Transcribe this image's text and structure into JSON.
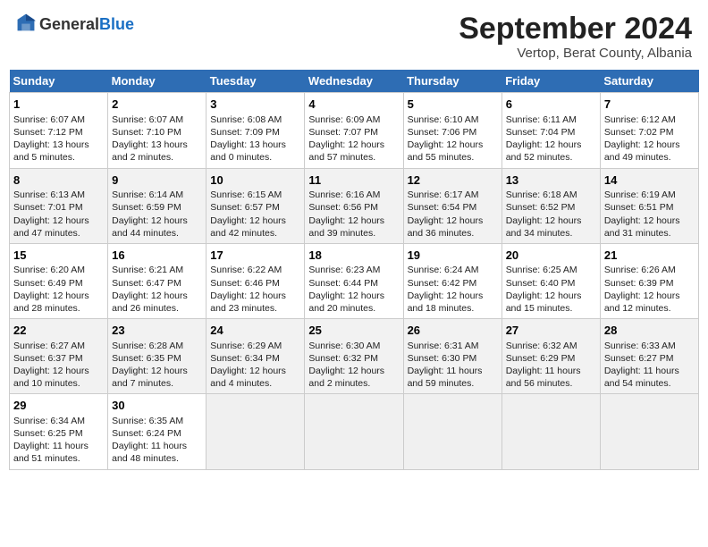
{
  "header": {
    "logo_general": "General",
    "logo_blue": "Blue",
    "month_title": "September 2024",
    "location": "Vertop, Berat County, Albania"
  },
  "columns": [
    "Sunday",
    "Monday",
    "Tuesday",
    "Wednesday",
    "Thursday",
    "Friday",
    "Saturday"
  ],
  "weeks": [
    [
      {
        "day": "1",
        "sunrise": "6:07 AM",
        "sunset": "7:12 PM",
        "daylight": "13 hours and 5 minutes."
      },
      {
        "day": "2",
        "sunrise": "6:07 AM",
        "sunset": "7:10 PM",
        "daylight": "13 hours and 2 minutes."
      },
      {
        "day": "3",
        "sunrise": "6:08 AM",
        "sunset": "7:09 PM",
        "daylight": "13 hours and 0 minutes."
      },
      {
        "day": "4",
        "sunrise": "6:09 AM",
        "sunset": "7:07 PM",
        "daylight": "12 hours and 57 minutes."
      },
      {
        "day": "5",
        "sunrise": "6:10 AM",
        "sunset": "7:06 PM",
        "daylight": "12 hours and 55 minutes."
      },
      {
        "day": "6",
        "sunrise": "6:11 AM",
        "sunset": "7:04 PM",
        "daylight": "12 hours and 52 minutes."
      },
      {
        "day": "7",
        "sunrise": "6:12 AM",
        "sunset": "7:02 PM",
        "daylight": "12 hours and 49 minutes."
      }
    ],
    [
      {
        "day": "8",
        "sunrise": "6:13 AM",
        "sunset": "7:01 PM",
        "daylight": "12 hours and 47 minutes."
      },
      {
        "day": "9",
        "sunrise": "6:14 AM",
        "sunset": "6:59 PM",
        "daylight": "12 hours and 44 minutes."
      },
      {
        "day": "10",
        "sunrise": "6:15 AM",
        "sunset": "6:57 PM",
        "daylight": "12 hours and 42 minutes."
      },
      {
        "day": "11",
        "sunrise": "6:16 AM",
        "sunset": "6:56 PM",
        "daylight": "12 hours and 39 minutes."
      },
      {
        "day": "12",
        "sunrise": "6:17 AM",
        "sunset": "6:54 PM",
        "daylight": "12 hours and 36 minutes."
      },
      {
        "day": "13",
        "sunrise": "6:18 AM",
        "sunset": "6:52 PM",
        "daylight": "12 hours and 34 minutes."
      },
      {
        "day": "14",
        "sunrise": "6:19 AM",
        "sunset": "6:51 PM",
        "daylight": "12 hours and 31 minutes."
      }
    ],
    [
      {
        "day": "15",
        "sunrise": "6:20 AM",
        "sunset": "6:49 PM",
        "daylight": "12 hours and 28 minutes."
      },
      {
        "day": "16",
        "sunrise": "6:21 AM",
        "sunset": "6:47 PM",
        "daylight": "12 hours and 26 minutes."
      },
      {
        "day": "17",
        "sunrise": "6:22 AM",
        "sunset": "6:46 PM",
        "daylight": "12 hours and 23 minutes."
      },
      {
        "day": "18",
        "sunrise": "6:23 AM",
        "sunset": "6:44 PM",
        "daylight": "12 hours and 20 minutes."
      },
      {
        "day": "19",
        "sunrise": "6:24 AM",
        "sunset": "6:42 PM",
        "daylight": "12 hours and 18 minutes."
      },
      {
        "day": "20",
        "sunrise": "6:25 AM",
        "sunset": "6:40 PM",
        "daylight": "12 hours and 15 minutes."
      },
      {
        "day": "21",
        "sunrise": "6:26 AM",
        "sunset": "6:39 PM",
        "daylight": "12 hours and 12 minutes."
      }
    ],
    [
      {
        "day": "22",
        "sunrise": "6:27 AM",
        "sunset": "6:37 PM",
        "daylight": "12 hours and 10 minutes."
      },
      {
        "day": "23",
        "sunrise": "6:28 AM",
        "sunset": "6:35 PM",
        "daylight": "12 hours and 7 minutes."
      },
      {
        "day": "24",
        "sunrise": "6:29 AM",
        "sunset": "6:34 PM",
        "daylight": "12 hours and 4 minutes."
      },
      {
        "day": "25",
        "sunrise": "6:30 AM",
        "sunset": "6:32 PM",
        "daylight": "12 hours and 2 minutes."
      },
      {
        "day": "26",
        "sunrise": "6:31 AM",
        "sunset": "6:30 PM",
        "daylight": "11 hours and 59 minutes."
      },
      {
        "day": "27",
        "sunrise": "6:32 AM",
        "sunset": "6:29 PM",
        "daylight": "11 hours and 56 minutes."
      },
      {
        "day": "28",
        "sunrise": "6:33 AM",
        "sunset": "6:27 PM",
        "daylight": "11 hours and 54 minutes."
      }
    ],
    [
      {
        "day": "29",
        "sunrise": "6:34 AM",
        "sunset": "6:25 PM",
        "daylight": "11 hours and 51 minutes."
      },
      {
        "day": "30",
        "sunrise": "6:35 AM",
        "sunset": "6:24 PM",
        "daylight": "11 hours and 48 minutes."
      },
      null,
      null,
      null,
      null,
      null
    ]
  ]
}
